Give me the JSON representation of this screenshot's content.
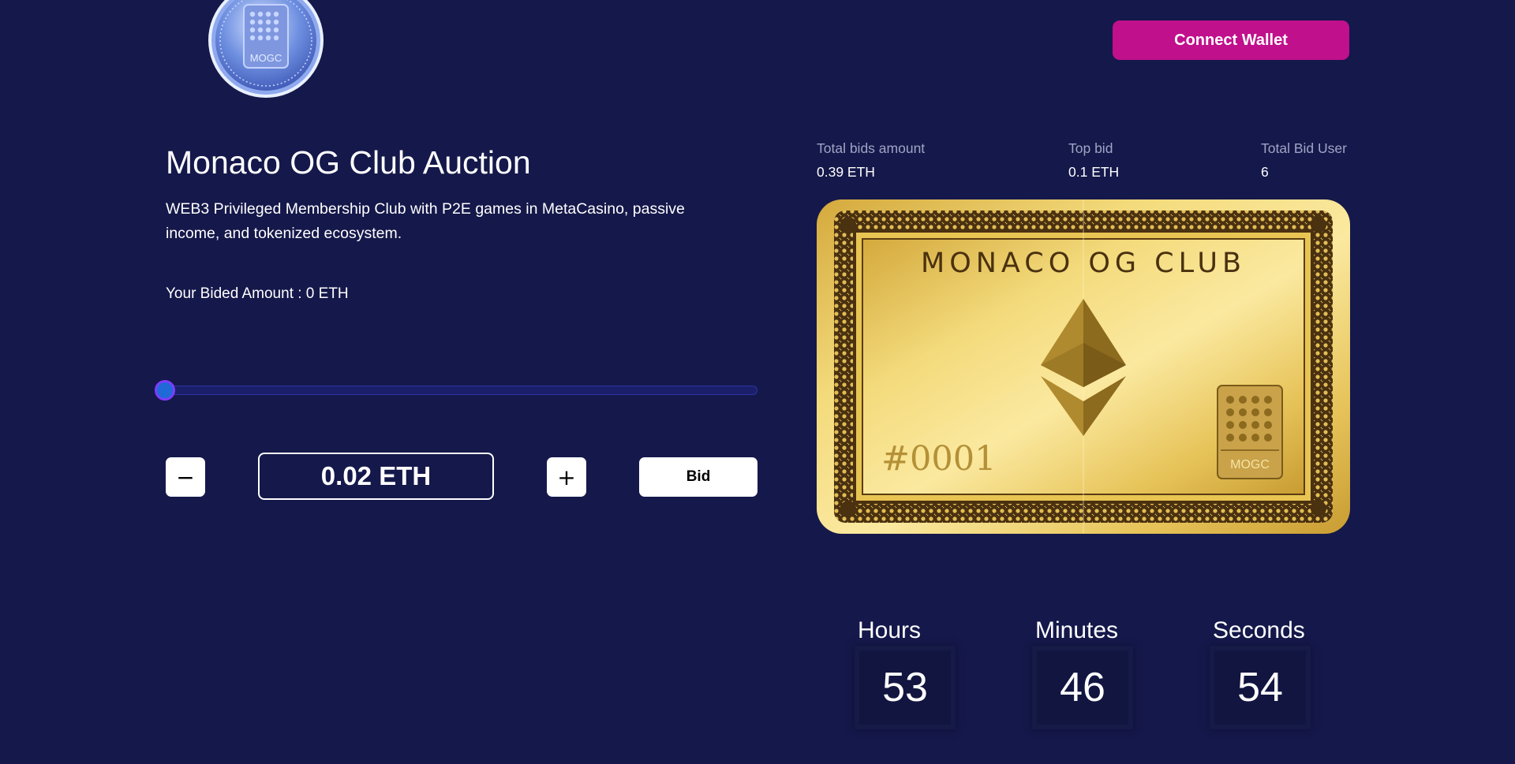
{
  "header": {
    "logo_text": "MOGC",
    "connect_label": "Connect Wallet"
  },
  "auction": {
    "title": "Monaco OG Club Auction",
    "description": "WEB3 Privileged Membership Club with P2E games in MetaCasino, passive income, and tokenized ecosystem.",
    "your_bided": "Your Bided Amount : 0 ETH",
    "slider_level": 0,
    "minus_label": "−",
    "plus_label": "+",
    "amount_value": "0.02 ETH",
    "bid_label": "Bid"
  },
  "stats": {
    "total_bids_label": "Total bids amount",
    "total_bids_value": "0.39 ETH",
    "top_bid_label": "Top bid",
    "top_bid_value": "0.1 ETH",
    "total_users_label": "Total Bid User",
    "total_users_value": "6"
  },
  "card": {
    "title": "MONACO OG CLUB",
    "number": "#0001",
    "badge_text": "MOGC"
  },
  "countdown": {
    "hours_label": "Hours",
    "hours_value": "53",
    "minutes_label": "Minutes",
    "minutes_value": "46",
    "seconds_label": "Seconds",
    "seconds_value": "54"
  },
  "colors": {
    "background": "#15184a",
    "connect_button": "#c0108c",
    "slider_thumb": "#1f6ad6",
    "card_gold": "#e8c553"
  }
}
